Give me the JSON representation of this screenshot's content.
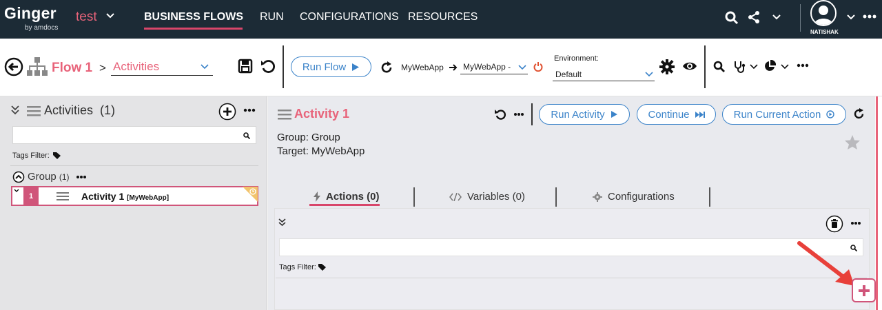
{
  "topbar": {
    "logo": "Ginger",
    "logo_sub": "by amdocs",
    "solution": "test",
    "nav": [
      "BUSINESS FLOWS",
      "RUN",
      "CONFIGURATIONS",
      "RESOURCES"
    ],
    "user": "NATISHAK"
  },
  "toolbar": {
    "flow_name": "Flow 1",
    "separator": ">",
    "view": "Activities",
    "run_flow": "Run Flow",
    "app_from": "MyWebApp",
    "app_to": "MyWebApp -",
    "env_label": "Environment:",
    "env_value": "Default"
  },
  "left_panel": {
    "title": "Activities",
    "count": "(1)",
    "tags_filter": "Tags Filter:",
    "group_name": "Group",
    "group_count": "(1)",
    "activity": {
      "index": "1",
      "name": "Activity 1",
      "target": "[MyWebApp]"
    }
  },
  "right_panel": {
    "title": "Activity 1",
    "run_activity": "Run Activity",
    "continue": "Continue",
    "run_current_action": "Run Current Action",
    "group_line": "Group: Group",
    "target_line": "Target: MyWebApp",
    "tabs": [
      {
        "label": "Actions (0)"
      },
      {
        "label": "Variables (0)"
      },
      {
        "label": "Configurations"
      }
    ],
    "tags_filter": "Tags Filter:"
  },
  "colors": {
    "nav_bg": "#1c2b36",
    "accent": "#e8637a",
    "accent_dark": "#d0557a",
    "link_blue": "#3b83c9",
    "panel_bg": "#e4e4e6"
  }
}
